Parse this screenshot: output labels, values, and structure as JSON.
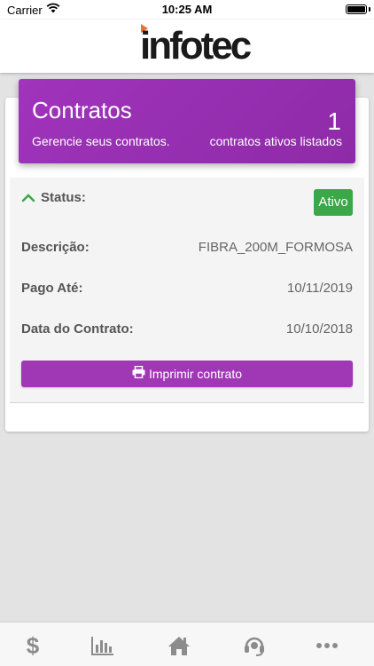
{
  "status_bar": {
    "carrier": "Carrier",
    "time": "10:25 AM"
  },
  "header": {
    "logo_text": "infotec",
    "logo_arrow_color": "#e8732a"
  },
  "contracts_card": {
    "title": "Contratos",
    "subtitle": "Gerencie seus contratos.",
    "count": "1",
    "count_label": "contratos ativos listados",
    "color": "#9a30b4"
  },
  "contract": {
    "status_label": "Status:",
    "status_value": "Ativo",
    "status_color": "#3aa748",
    "description_label": "Descrição:",
    "description_value": "FIBRA_200M_FORMOSA",
    "paid_until_label": "Pago Até:",
    "paid_until_value": "10/11/2019",
    "contract_date_label": "Data do Contrato:",
    "contract_date_value": "10/10/2018",
    "print_button": "Imprimir contrato"
  },
  "tabs": [
    {
      "icon": "dollar-icon"
    },
    {
      "icon": "bar-chart-icon"
    },
    {
      "icon": "home-icon"
    },
    {
      "icon": "headset-icon"
    },
    {
      "icon": "more-icon"
    }
  ]
}
